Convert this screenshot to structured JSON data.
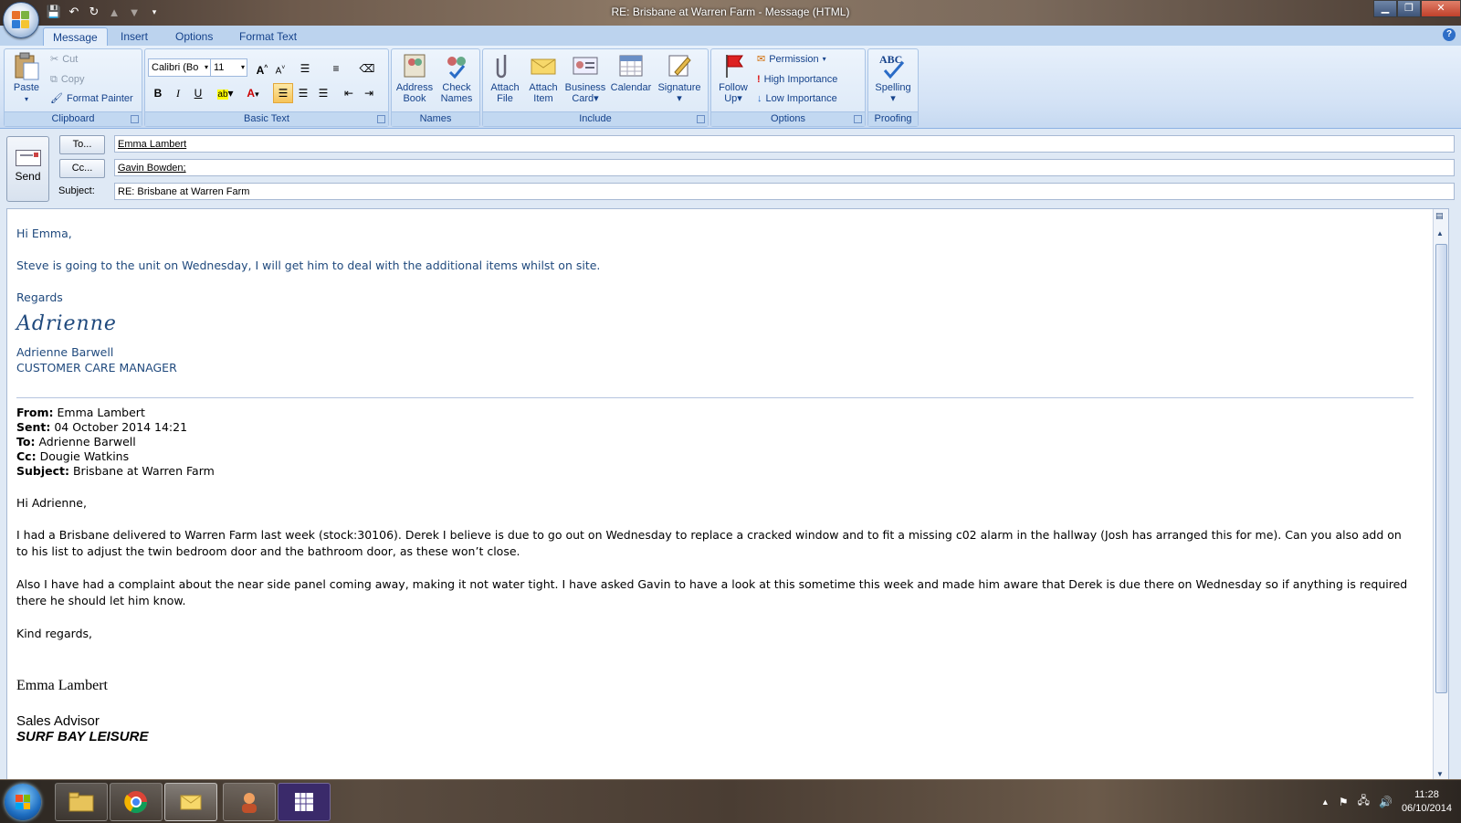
{
  "window": {
    "title": "RE: Brisbane at Warren Farm - Message (HTML)",
    "minimize": "▁",
    "maximize": "❐",
    "close": "✕"
  },
  "tabs": [
    "Message",
    "Insert",
    "Options",
    "Format Text"
  ],
  "ribbon": {
    "clipboard": {
      "label": "Clipboard",
      "paste": "Paste",
      "cut": "Cut",
      "copy": "Copy",
      "format_painter": "Format Painter"
    },
    "basic_text": {
      "label": "Basic Text",
      "font": "Calibri (Bo",
      "size": "11",
      "bold": "B",
      "italic": "I",
      "underline": "U"
    },
    "names": {
      "label": "Names",
      "address_book": [
        "Address",
        "Book"
      ],
      "check_names": [
        "Check",
        "Names"
      ]
    },
    "include": {
      "label": "Include",
      "attach_file": [
        "Attach",
        "File"
      ],
      "attach_item": [
        "Attach",
        "Item"
      ],
      "business_card": [
        "Business",
        "Card"
      ],
      "calendar": "Calendar",
      "signature": "Signature"
    },
    "options": {
      "label": "Options",
      "follow_up": [
        "Follow",
        "Up"
      ],
      "permission": "Permission",
      "high_importance": "High Importance",
      "low_importance": "Low Importance"
    },
    "proofing": {
      "label": "Proofing",
      "spelling": "Spelling",
      "abc": "ABC"
    }
  },
  "header": {
    "send": "Send",
    "to_button": "To...",
    "cc_button": "Cc...",
    "subject_label": "Subject:",
    "to": "Emma Lambert",
    "cc": "Gavin Bowden;",
    "subject": "RE: Brisbane at Warren Farm"
  },
  "reply": {
    "greeting": "Hi Emma,",
    "line1": "Steve is going to the unit on Wednesday, I will get him to deal with the additional items whilst on site.",
    "closing": "Regards",
    "signature_script": "Adrienne",
    "name": "Adrienne Barwell",
    "role": "CUSTOMER CARE MANAGER"
  },
  "original": {
    "from_label": "From:",
    "from": "Emma Lambert",
    "sent_label": "Sent:",
    "sent": "04 October 2014 14:21",
    "to_label": "To:",
    "to": "Adrienne Barwell",
    "cc_label": "Cc:",
    "cc": "Dougie Watkins",
    "subject_label": "Subject:",
    "subject": "Brisbane at Warren Farm",
    "greeting": "Hi Adrienne,",
    "para1": "I had a Brisbane delivered to Warren Farm last week (stock:30106). Derek I believe is due to go out on Wednesday to replace a cracked window and to fit a missing c02 alarm in the hallway (Josh has arranged this for me). Can you also add on to his list to adjust the twin bedroom door and the bathroom door, as these won’t close.",
    "para2": "Also I have had a complaint about the near side panel coming away, making it not water tight. I have asked Gavin to have a look at this sometime this week and made him aware that Derek is due there on Wednesday so if anything is required there he should let him know.",
    "closing": "Kind regards,",
    "name": "Emma Lambert",
    "role": "Sales Advisor",
    "company": "SURF BAY LEISURE"
  },
  "taskbar": {
    "time": "11:28",
    "date": "06/10/2014"
  }
}
